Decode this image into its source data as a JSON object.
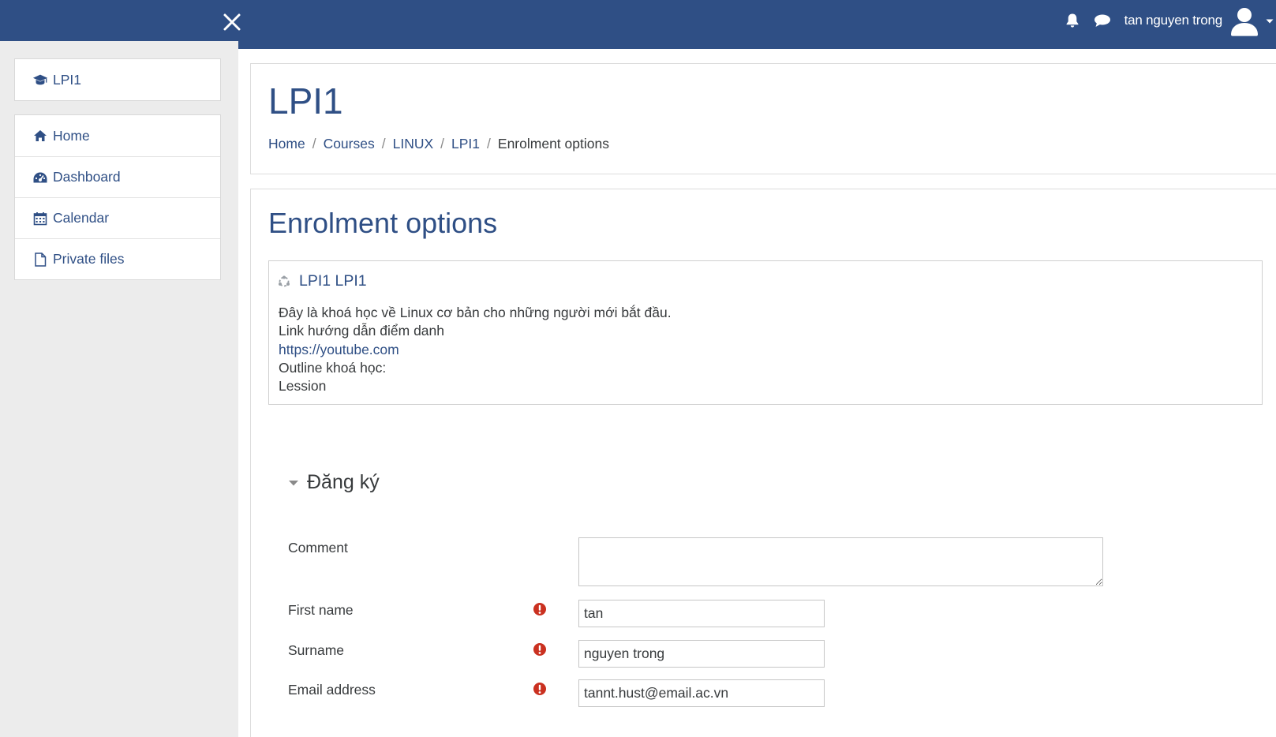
{
  "navbar": {
    "close_label": "Close drawer",
    "user_name": "tan nguyen trong",
    "icons": [
      "close-icon",
      "bell-icon",
      "chat-icon",
      "user-avatar-icon",
      "caret-down-icon"
    ],
    "color": "#2f4f85"
  },
  "sidebar": {
    "course": {
      "label": "LPI1",
      "icon": "graduation-cap-icon"
    },
    "items": [
      {
        "label": "Home",
        "icon": "home-icon"
      },
      {
        "label": "Dashboard",
        "icon": "dashboard-icon"
      },
      {
        "label": "Calendar",
        "icon": "calendar-icon"
      },
      {
        "label": "Private files",
        "icon": "file-icon"
      }
    ]
  },
  "header": {
    "title": "LPI1",
    "breadcrumb": [
      "Home",
      "Courses",
      "LINUX",
      "LPI1",
      "Enrolment options"
    ]
  },
  "main": {
    "heading": "Enrolment options",
    "course": {
      "title": "LPI1 LPI1",
      "icon": "course-icon",
      "summary": [
        "Đây là khoá học về Linux cơ bản cho những người mới bắt đầu.",
        "Link hướng dẫn điểm danh",
        "https://youtube.com",
        "Outline khoá học:",
        "Lession"
      ]
    },
    "section_title": "Đăng ký",
    "form": {
      "comment_label": "Comment",
      "comment_value": "",
      "firstname_label": "First name",
      "firstname_value": "tan",
      "surname_label": "Surname",
      "surname_value": "nguyen trong",
      "email_label": "Email address",
      "email_value": "tannt.hust@email.ac.vn"
    }
  },
  "colors": {
    "brand": "#2f4f85",
    "required": "#ca3120",
    "sidebar_bg": "#ececec"
  }
}
